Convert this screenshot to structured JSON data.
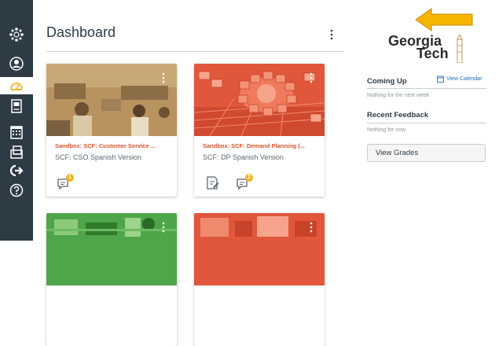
{
  "header": {
    "title": "Dashboard"
  },
  "courses": [
    {
      "title": "Sandbox: SCF: Customer Service ...",
      "subtitle": "SCF: CSO Spanish Version",
      "badge": "1"
    },
    {
      "title": "Sandbox: SCF: Demand Planning (...",
      "subtitle": "SCF: DP Spanish Version",
      "badge": "2"
    }
  ],
  "sidebar": {
    "logo_line1": "Georgia",
    "logo_line2": "Tech",
    "coming_up": {
      "heading": "Coming Up",
      "link": "View Calendar",
      "note": "Nothing for the next week"
    },
    "recent_feedback": {
      "heading": "Recent Feedback",
      "note": "Nothing for now"
    },
    "view_grades": "View Grades"
  },
  "colors": {
    "nav_bg": "#2d3b45",
    "accent_orange": "#d9532a",
    "badge_yellow": "#f0b321",
    "annotation_arrow": "#f5b400"
  },
  "nav_icons": [
    "canvas-logo-icon",
    "account-icon",
    "dashboard-icon",
    "courses-icon",
    "calendar-icon",
    "inbox-icon",
    "commons-icon",
    "help-icon"
  ]
}
